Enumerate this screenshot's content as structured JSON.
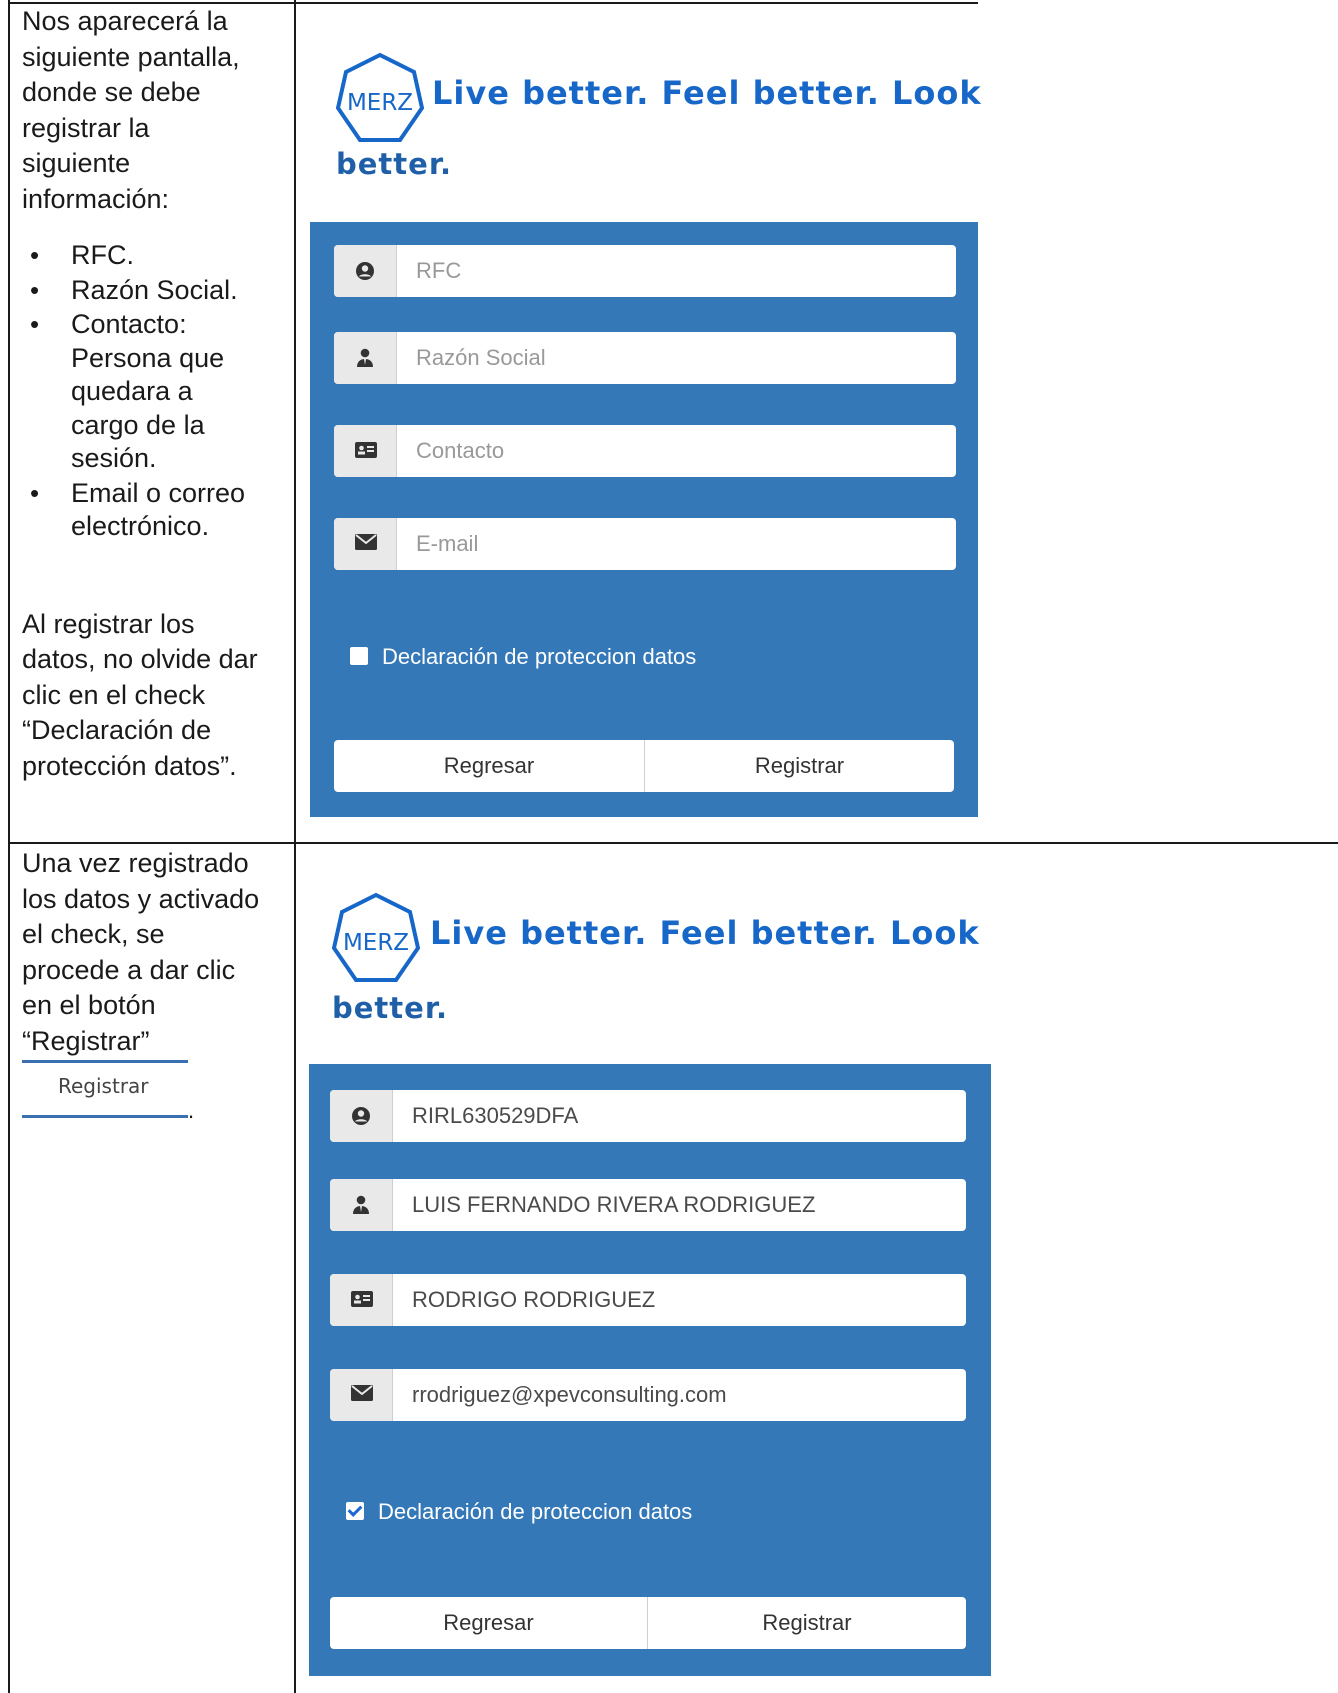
{
  "step1": {
    "intro": [
      "Nos aparecerá la",
      "siguiente pantalla,",
      "donde se debe",
      "registrar la",
      "siguiente",
      "información:"
    ],
    "bullets": [
      [
        "RFC."
      ],
      [
        "Razón Social."
      ],
      [
        "Contacto:",
        "Persona que",
        "quedara a",
        "cargo de la",
        "sesión."
      ],
      [
        "Email o correo",
        "electrónico."
      ]
    ],
    "note": [
      "Al registrar los",
      "datos, no olvide dar",
      "clic en el check",
      "“Declaración de",
      "protección datos”."
    ],
    "screen": {
      "logo_text": "MERZ",
      "tagline_line1": "Live better. Feel better. Look",
      "tagline_line2": "better.",
      "fields": [
        {
          "icon": "user-circle-icon",
          "text": "RFC",
          "filled": false
        },
        {
          "icon": "user-tie-icon",
          "text": "Razón Social",
          "filled": false
        },
        {
          "icon": "id-card-icon",
          "text": "Contacto",
          "filled": false
        },
        {
          "icon": "envelope-icon",
          "text": "E-mail",
          "filled": false
        }
      ],
      "checkbox_label": "Declaración de proteccion datos",
      "checkbox_checked": false,
      "back_label": "Regresar",
      "register_label": "Registrar"
    }
  },
  "step2": {
    "intro": [
      "Una vez registrado",
      "los datos y activado",
      "el check, se",
      "procede a dar clic",
      "en el botón",
      "“Registrar”"
    ],
    "button_image_label": "Registrar",
    "trailing_period": ".",
    "screen": {
      "logo_text": "MERZ",
      "tagline_line1": "Live better. Feel better. Look",
      "tagline_line2": "better.",
      "fields": [
        {
          "icon": "user-circle-icon",
          "text": "RIRL630529DFA",
          "filled": true
        },
        {
          "icon": "user-tie-icon",
          "text": "LUIS FERNANDO RIVERA RODRIGUEZ",
          "filled": true
        },
        {
          "icon": "id-card-icon",
          "text": "RODRIGO RODRIGUEZ",
          "filled": true
        },
        {
          "icon": "envelope-icon",
          "text": "rrodriguez@xpevconsulting.com",
          "filled": true
        }
      ],
      "checkbox_label": "Declaración de proteccion datos",
      "checkbox_checked": true,
      "back_label": "Regresar",
      "register_label": "Registrar"
    }
  },
  "colors": {
    "panel_blue": "#3478b8",
    "tagline_blue": "#1767c8",
    "checkbox_tick": "#1b66d8"
  }
}
